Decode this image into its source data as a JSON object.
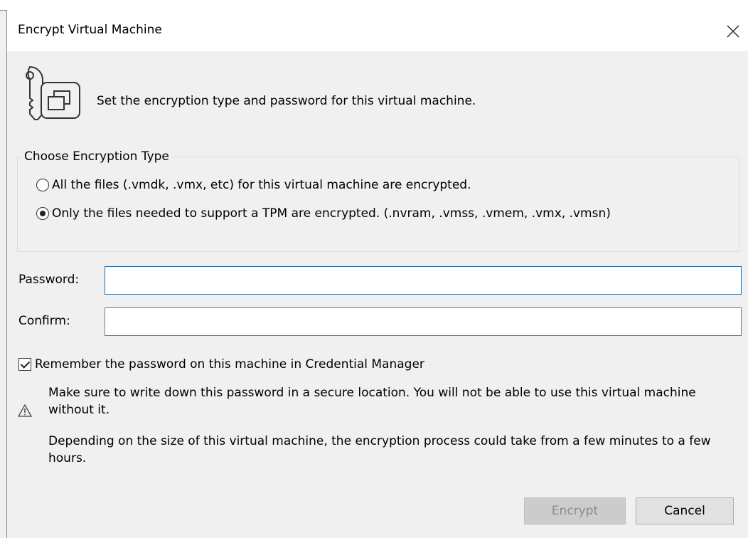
{
  "window": {
    "title": "Encrypt Virtual Machine"
  },
  "icons": {
    "header": "key-vm-icon",
    "close": "close-icon",
    "warning": "warning-icon"
  },
  "intro": "Set the encryption type and password for this virtual machine.",
  "encryption_group": {
    "legend": "Choose Encryption Type",
    "options": [
      {
        "label": "All the files (.vmdk, .vmx, etc) for this virtual machine are encrypted.",
        "checked": false
      },
      {
        "label": "Only the files needed to support a TPM are encrypted. (.nvram, .vmss, .vmem, .vmx, .vmsn)",
        "checked": true
      }
    ]
  },
  "password": {
    "label": "Password:",
    "value": ""
  },
  "confirm": {
    "label": "Confirm:",
    "value": ""
  },
  "remember": {
    "label": "Remember the password on this machine in Credential Manager",
    "checked": true
  },
  "warning": {
    "line1": "Make sure to write down this password in a secure location. You will not be able to use this virtual machine without it.",
    "line2": "Depending on the size of this virtual machine, the encryption process could take from a few minutes to a few hours."
  },
  "buttons": {
    "encrypt": "Encrypt",
    "encrypt_enabled": false,
    "cancel": "Cancel"
  },
  "colors": {
    "focus_border": "#0078d7",
    "disabled_button": "#cccccc"
  }
}
